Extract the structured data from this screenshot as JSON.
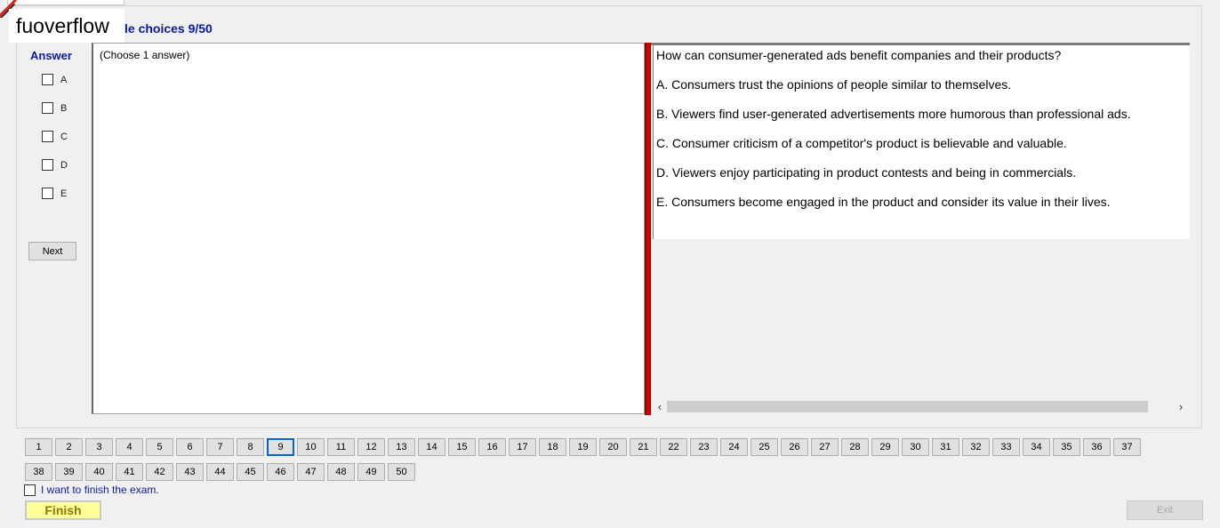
{
  "watermark": "fuoverflow",
  "section_title": "le choices 9/50",
  "answer": {
    "heading": "Answer",
    "options": [
      "A",
      "B",
      "C",
      "D",
      "E"
    ],
    "next_label": "Next"
  },
  "choose_hint": "(Choose 1 answer)",
  "question": {
    "text": "How can consumer-generated ads benefit companies and their products?",
    "options": [
      "A.  Consumers trust the opinions of people similar to themselves.",
      "B.  Viewers find user-generated advertisements more humorous than professional ads.",
      "C.  Consumer criticism of a competitor's product is believable and valuable.",
      "D.  Viewers enjoy participating in product contests and being in commercials.",
      "E.  Consumers become engaged in the product and consider its value in their lives."
    ]
  },
  "nav": {
    "questions": [
      "1",
      "2",
      "3",
      "4",
      "5",
      "6",
      "7",
      "8",
      "9",
      "10",
      "11",
      "12",
      "13",
      "14",
      "15",
      "16",
      "17",
      "18",
      "19",
      "20",
      "21",
      "22",
      "23",
      "24",
      "25",
      "26",
      "27",
      "28",
      "29",
      "30",
      "31",
      "32",
      "33",
      "34",
      "35",
      "36",
      "37",
      "38",
      "39",
      "40",
      "41",
      "42",
      "43",
      "44",
      "45",
      "46",
      "47",
      "48",
      "49",
      "50"
    ],
    "current": 9
  },
  "finish": {
    "checkbox_label": "I want to finish the exam.",
    "finish_label": "Finish",
    "exit_label": "Exit"
  }
}
